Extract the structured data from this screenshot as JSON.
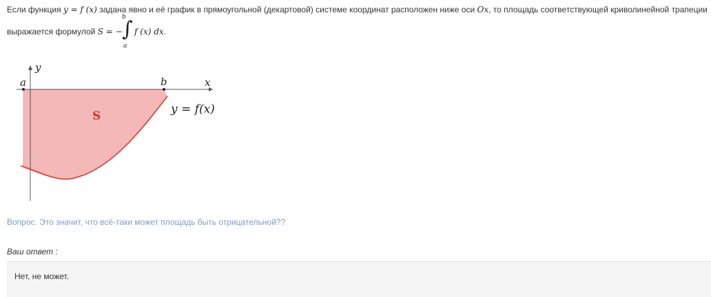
{
  "paragraph": {
    "p1_text1": "Если функция ",
    "p1_math1": "y = f (x)",
    "p1_text2": " задана явно и её график в прямоугольной (декартовой) системе координат расположен ниже оси ",
    "p1_math2": "Ox",
    "p1_text3": ", то площадь соответствующей криволинейной трапеции",
    "p2_text1": "выражается формулой ",
    "p2_math_lhs": "S = −",
    "integral_upper": "b",
    "integral_lower": "a",
    "integral_sign": "∫",
    "p2_math_integrand": "f (x) dx",
    "p2_text_end": "."
  },
  "graph": {
    "label_y": "y",
    "label_x": "x",
    "label_a": "a",
    "label_b": "b",
    "label_area": "S",
    "label_function": "y = f(x)",
    "fill_color": "#f4b8b8",
    "curve_color": "#e0392b",
    "area_label_color": "#d9322a"
  },
  "question": "Вопрос. Это значит, что всё-таки может площадь быть отрицательной??",
  "answer": {
    "label": "Ваш ответ :",
    "text": "Нет, не может."
  }
}
